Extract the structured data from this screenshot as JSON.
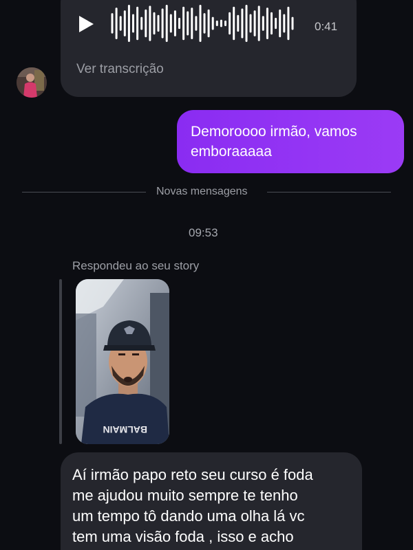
{
  "voice_message": {
    "duration": "0:41",
    "transcription_link": "Ver transcrição"
  },
  "sent_message": {
    "text": "Demoroooo irmão, vamos emboraaaaa"
  },
  "divider": {
    "label": "Novas mensagens"
  },
  "timestamp": "09:53",
  "story_reply": {
    "label": "Respondeu ao seu story",
    "thumbnail_shirt_text": "BALMAIN"
  },
  "received_message": {
    "text": "Aí irmão papo reto seu curso é foda\nme ajudou muito sempre te tenho\num tempo tô dando uma olha lá vc\ntem uma visão foda , isso e acho"
  },
  "colors": {
    "background": "#0c0d12",
    "bubble_received": "#25262d",
    "bubble_sent": "#9b3bf5",
    "muted_text": "#9d9fa6"
  }
}
